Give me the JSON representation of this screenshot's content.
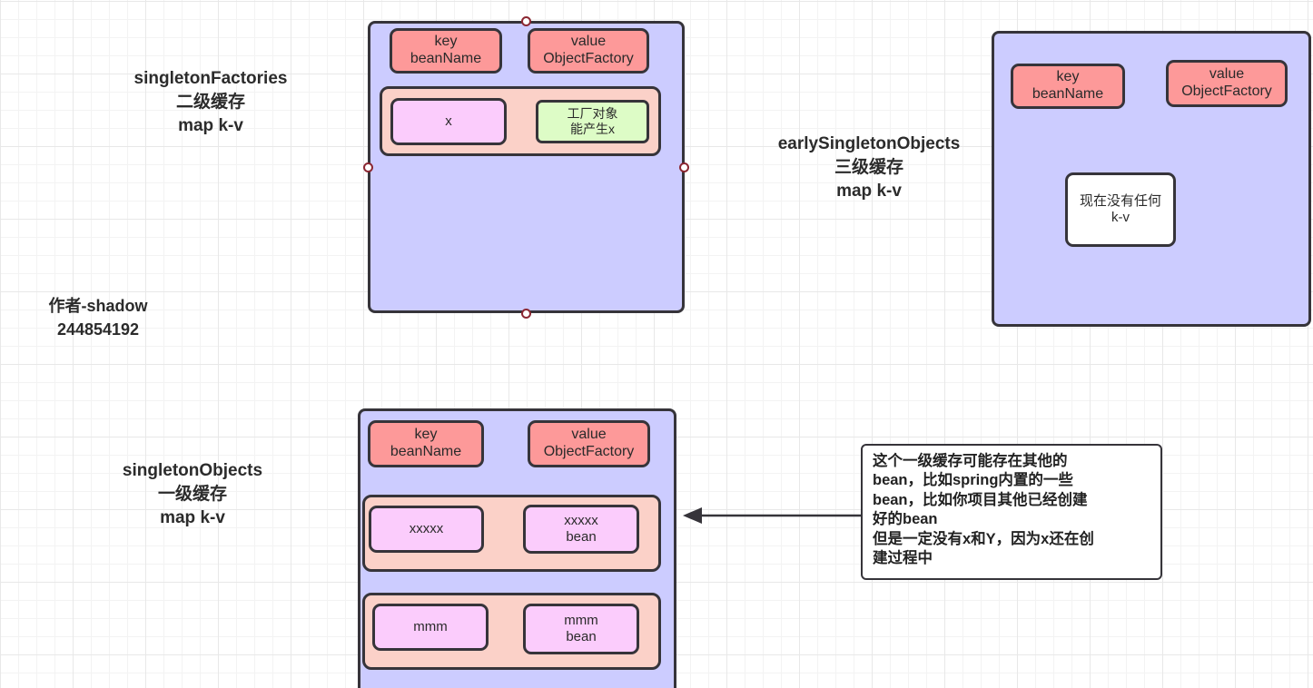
{
  "diagram": {
    "title_labels": {
      "singleton_factories": "singletonFactories\n二级缓存\nmap k-v",
      "early_singleton_objects": "earlySingletonObjects\n三级缓存\nmap k-v",
      "singleton_objects": "singletonObjects\n一级缓存\nmap k-v"
    },
    "credit": "作者-shadow\n244854192",
    "singleton_factories_box": {
      "key_header": "key\nbeanName",
      "value_header": "value\nObjectFactory",
      "entry": {
        "key_cell": "x",
        "value_cell": "工厂对象\n能产生x"
      }
    },
    "early_singleton_objects_box": {
      "key_header": "key\nbeanName",
      "value_header": "value\nObjectFactory",
      "empty_note": "现在没有任何\nk-v"
    },
    "singleton_objects_box": {
      "key_header": "key\nbeanName",
      "value_header": "value\nObjectFactory",
      "entries": [
        {
          "key_cell": "xxxxx",
          "value_cell": "xxxxx\nbean"
        },
        {
          "key_cell": "mmm",
          "value_cell": "mmm\nbean"
        }
      ]
    },
    "annotation": {
      "text": "这个一级缓存可能存在其他的\nbean，比如spring内置的一些\nbean，比如你项目其他已经创建\n好的bean\n但是一定没有x和Y，因为x还在创\n建过程中"
    },
    "colors": {
      "map_box_fill": "#ccccff",
      "header_fill": "#fd9999",
      "row_group_fill": "#fbd1c8",
      "cell_pink_fill": "#fbccfc",
      "cell_green_fill": "#ddfcc6",
      "stroke": "#36343a",
      "handle_stroke": "#8b2732",
      "grid_minor": "#f3f3f3",
      "grid_major": "#e8e8e8"
    }
  }
}
